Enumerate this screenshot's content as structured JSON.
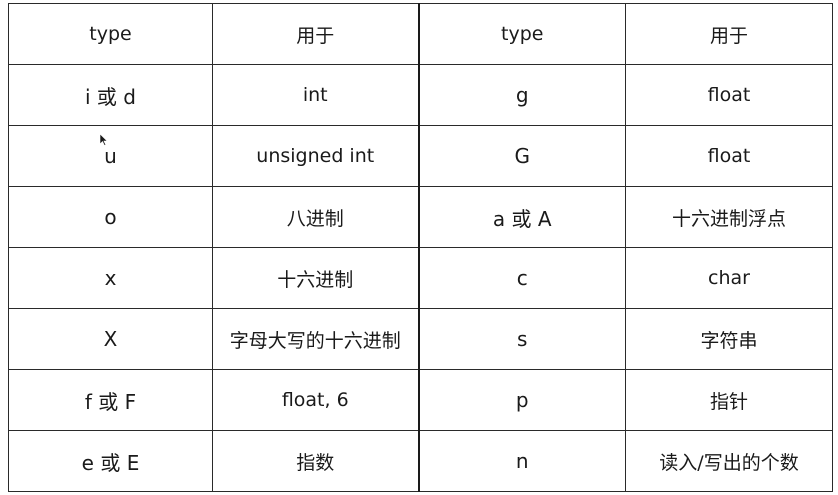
{
  "table": {
    "header": {
      "type_left": "type",
      "use_left": "用于",
      "type_right": "type",
      "use_right": "用于"
    },
    "rows": [
      {
        "type_left": "i 或 d",
        "use_left": "int",
        "type_right": "g",
        "use_right": "float"
      },
      {
        "type_left": "u",
        "use_left": "unsigned int",
        "type_right": "G",
        "use_right": "float"
      },
      {
        "type_left": "o",
        "use_left": "八进制",
        "type_right": "a 或 A",
        "use_right": "十六进制浮点"
      },
      {
        "type_left": "x",
        "use_left": "十六进制",
        "type_right": "c",
        "use_right": "char"
      },
      {
        "type_left": "X",
        "use_left": "字母大写的十六进制",
        "type_right": "s",
        "use_right": "字符串"
      },
      {
        "type_left": "f 或 F",
        "use_left": "float, 6",
        "type_right": "p",
        "use_right": "指针"
      },
      {
        "type_left": "e 或 E",
        "use_left": "指数",
        "type_right": "n",
        "use_right": "读入/写出的个数"
      }
    ]
  }
}
